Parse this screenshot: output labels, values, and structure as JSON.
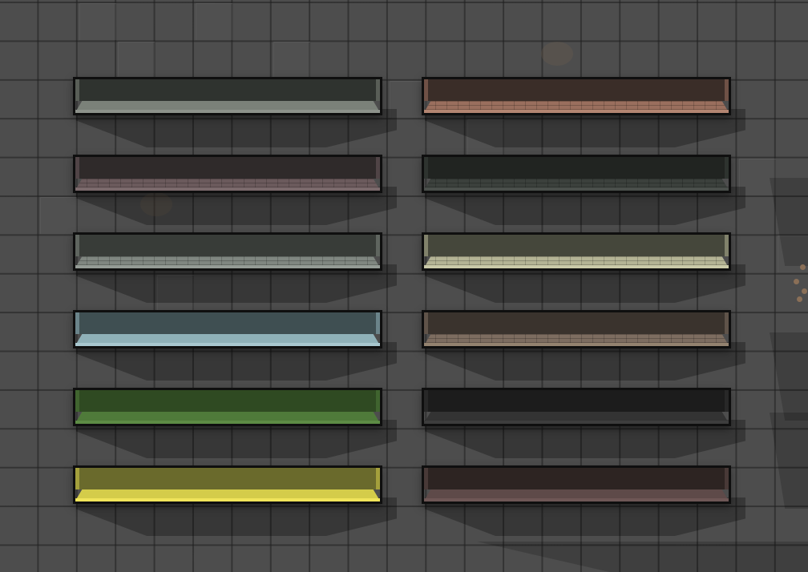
{
  "walls": [
    {
      "id": "wall-1",
      "top": "#2f332f",
      "bevel": "#7b8179",
      "base": "#8d928b",
      "brick": false
    },
    {
      "id": "wall-2",
      "top": "#3a2d28",
      "bevel": "#9a6f5e",
      "base": "#b38571",
      "brick": true
    },
    {
      "id": "wall-3",
      "top": "#2f2a2a",
      "bevel": "#6b5a5c",
      "base": "#7b6a6c",
      "brick": true
    },
    {
      "id": "wall-4",
      "top": "#212421",
      "bevel": "#3b403c",
      "base": "#4a4f4b",
      "brick": true
    },
    {
      "id": "wall-5",
      "top": "#383c38",
      "bevel": "#7f8680",
      "base": "#949b95",
      "brick": true
    },
    {
      "id": "wall-6",
      "top": "#45473b",
      "bevel": "#b3b394",
      "base": "#c9c9a8",
      "brick": true
    },
    {
      "id": "wall-7",
      "top": "#3f4f52",
      "bevel": "#8fb1b8",
      "base": "#a9c8cf",
      "brick": false
    },
    {
      "id": "wall-8",
      "top": "#3a332d",
      "bevel": "#7d6d60",
      "base": "#93826f",
      "brick": true
    },
    {
      "id": "wall-9",
      "top": "#2f4a22",
      "bevel": "#4f7a3a",
      "base": "#5d8c45",
      "brick": false
    },
    {
      "id": "wall-10",
      "top": "#1c1c1c",
      "bevel": "#333333",
      "base": "#3d3d3d",
      "brick": false
    },
    {
      "id": "wall-11",
      "top": "#6a6a2c",
      "bevel": "#d4cc4a",
      "base": "#f0e45a",
      "brick": false
    },
    {
      "id": "wall-12",
      "top": "#2d2422",
      "bevel": "#5e4a49",
      "base": "#6e5756",
      "brick": false
    }
  ]
}
